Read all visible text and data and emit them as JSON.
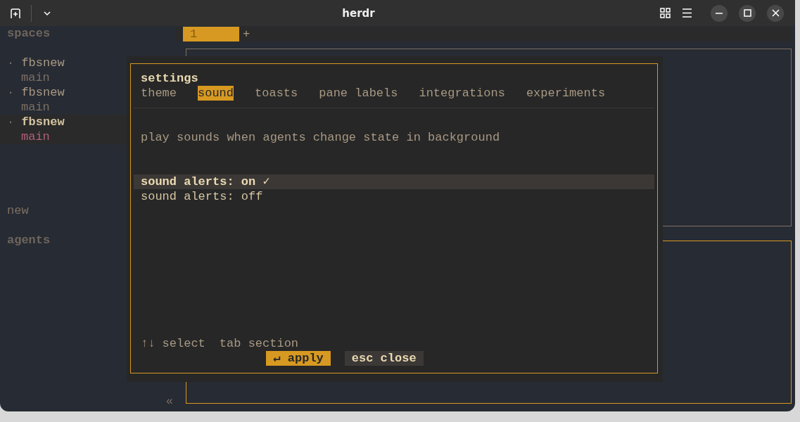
{
  "window": {
    "title": "herdr"
  },
  "sidebar": {
    "heading": "spaces",
    "spaces": [
      {
        "bullet": "·",
        "name": "fbsnew",
        "branch": "main",
        "selected": false
      },
      {
        "bullet": "·",
        "name": "fbsnew",
        "branch": "main",
        "selected": false
      },
      {
        "bullet": "·",
        "name": "fbsnew",
        "branch": "main",
        "selected": true
      }
    ],
    "new_label": "new",
    "agents_heading": "agents",
    "collapse": "«"
  },
  "tabs": [
    {
      "label": "1",
      "selected": true
    }
  ],
  "new_tab": "+",
  "settings": {
    "title": "settings",
    "sections": [
      {
        "label": "theme",
        "selected": false
      },
      {
        "label": "sound",
        "selected": true
      },
      {
        "label": "toasts",
        "selected": false
      },
      {
        "label": "pane labels",
        "selected": false
      },
      {
        "label": "integrations",
        "selected": false
      },
      {
        "label": "experiments",
        "selected": false
      }
    ],
    "description": "play sounds when agents change state in background",
    "options": [
      {
        "label": "sound alerts: on",
        "mark": "✓",
        "selected": true
      },
      {
        "label": "sound alerts: off",
        "selected": false
      }
    ],
    "hints": [
      "↑↓ select",
      "tab section"
    ],
    "buttons": [
      {
        "label": "↵ apply",
        "kind": "primary"
      },
      {
        "label": "esc close",
        "kind": "secondary"
      }
    ]
  }
}
